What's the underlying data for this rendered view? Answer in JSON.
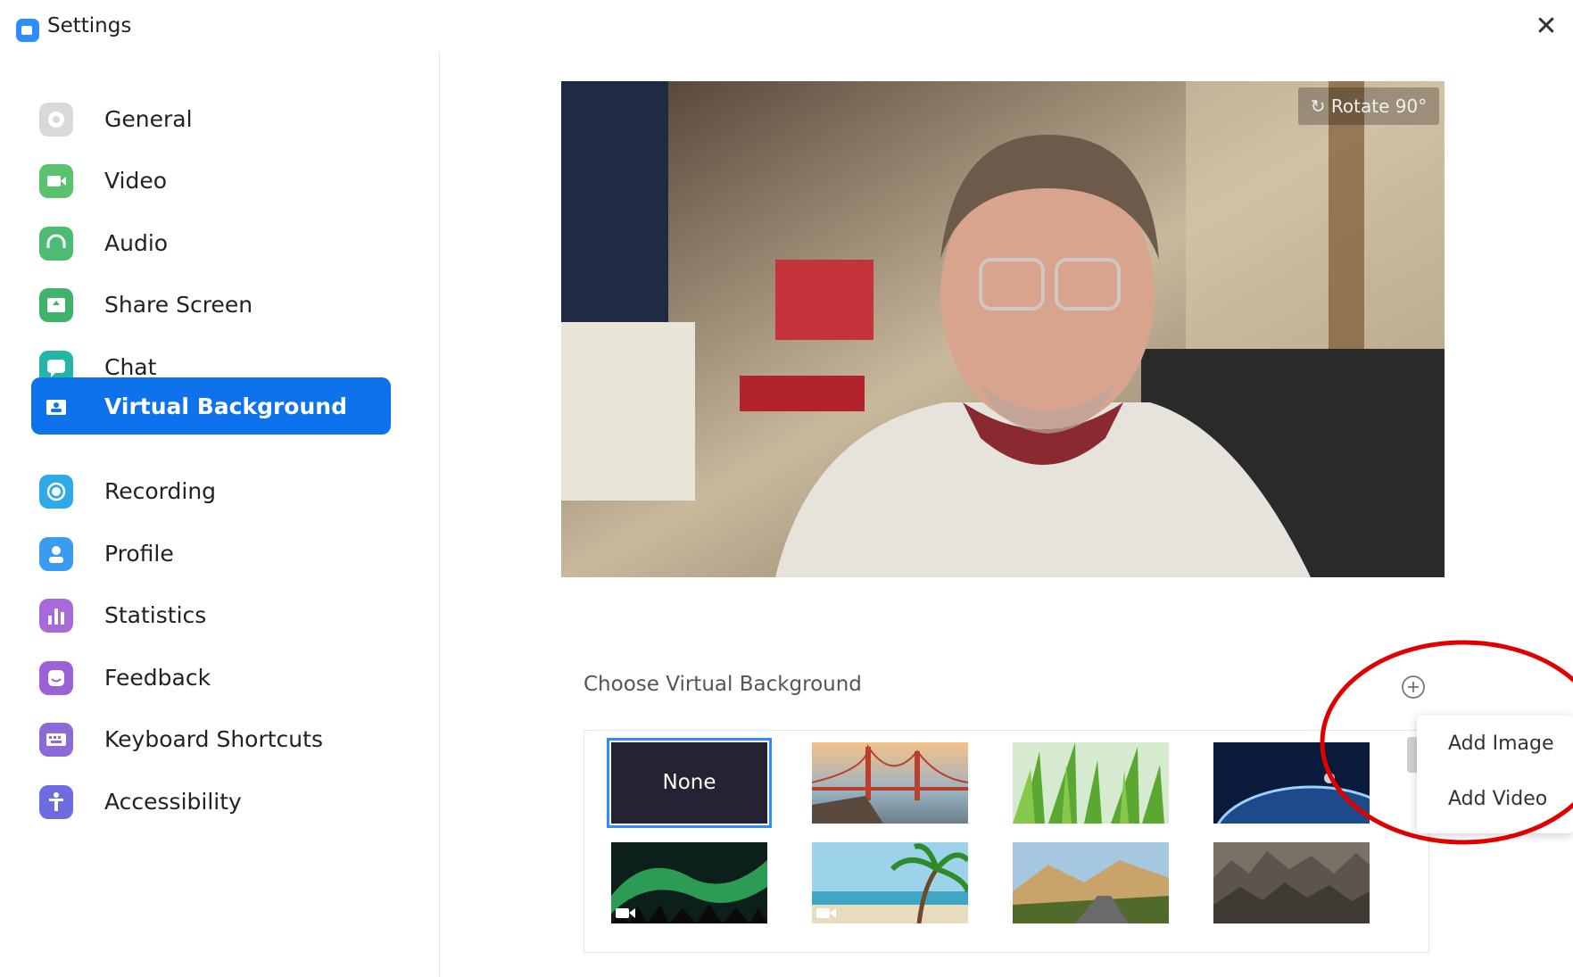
{
  "window": {
    "title": "Settings",
    "close_icon": "close-icon"
  },
  "sidebar": {
    "items": [
      {
        "label": "General",
        "icon": "gear-icon",
        "color": "#d9d9d9"
      },
      {
        "label": "Video",
        "icon": "video-camera-icon",
        "color": "#59c26d"
      },
      {
        "label": "Audio",
        "icon": "headphones-icon",
        "color": "#4cbb73"
      },
      {
        "label": "Share Screen",
        "icon": "share-screen-icon",
        "color": "#3fb36b"
      },
      {
        "label": "Chat",
        "icon": "chat-bubble-icon",
        "color": "#23b5a6"
      },
      {
        "label": "Virtual Background",
        "icon": "person-card-icon",
        "color": "#0e72ed",
        "active": true
      },
      {
        "label": "Recording",
        "icon": "record-icon",
        "color": "#2fa9e8"
      },
      {
        "label": "Profile",
        "icon": "user-icon",
        "color": "#3a9bf0"
      },
      {
        "label": "Statistics",
        "icon": "bar-chart-icon",
        "color": "#a86ad8"
      },
      {
        "label": "Feedback",
        "icon": "smile-icon",
        "color": "#9a62d6"
      },
      {
        "label": "Keyboard Shortcuts",
        "icon": "keyboard-icon",
        "color": "#8d6bd6"
      },
      {
        "label": "Accessibility",
        "icon": "accessibility-icon",
        "color": "#6d6ce0"
      }
    ]
  },
  "preview": {
    "rotate_label": "Rotate 90°",
    "rotate_icon": "rotate-icon"
  },
  "backgrounds": {
    "section_label": "Choose Virtual Background",
    "add_icon": "plus-circle-icon",
    "none_label": "None",
    "thumbnails": [
      {
        "name": "none"
      },
      {
        "name": "golden-gate-bridge"
      },
      {
        "name": "grass"
      },
      {
        "name": "earth-from-space"
      },
      {
        "name": "northern-lights",
        "video": true
      },
      {
        "name": "beach-palm",
        "video": true
      },
      {
        "name": "mountain-road"
      },
      {
        "name": "rocky-terrain"
      }
    ]
  },
  "add_menu": {
    "items": [
      "Add Image",
      "Add Video"
    ]
  },
  "colors": {
    "accent": "#0e72ed",
    "annotation": "#e00000"
  }
}
